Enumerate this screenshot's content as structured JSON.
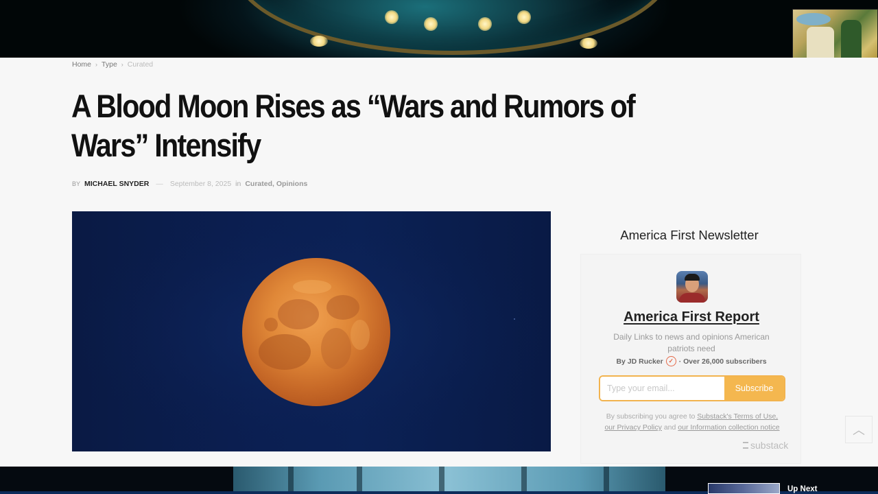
{
  "breadcrumb": {
    "home": "Home",
    "type": "Type",
    "current": "Curated"
  },
  "article": {
    "title": "A Blood Moon Rises as “Wars and Rumors of Wars” Intensify",
    "by_label": "BY",
    "author": "MICHAEL SNYDER",
    "date": "September 8, 2025",
    "in_label": "in",
    "categories": "Curated, Opinions",
    "hero_image": "blood-moon-photo"
  },
  "sidebar": {
    "heading": "America First Newsletter",
    "publication": "America First Report",
    "description": "Daily Links to news and opinions American patriots need",
    "byline_prefix": "By JD Rucker",
    "byline_suffix": "· Over 26,000 subscribers",
    "email_placeholder": "Type your email...",
    "subscribe_label": "Subscribe",
    "legal_prefix": "By subscribing you agree to",
    "terms_link": "Substack's Terms of Use,",
    "privacy_link": "our Privacy Policy",
    "legal_and": "and",
    "collection_link": "our Information collection notice",
    "brand": "substack"
  },
  "player": {
    "up_next_label": "Up Next"
  },
  "icons": {
    "verified": "check-circle-icon",
    "scroll_top": "chevron-up-icon"
  },
  "colors": {
    "accent": "#f4b74f",
    "hero_bg": "#0b1f52",
    "moon": "#e38a3a"
  }
}
